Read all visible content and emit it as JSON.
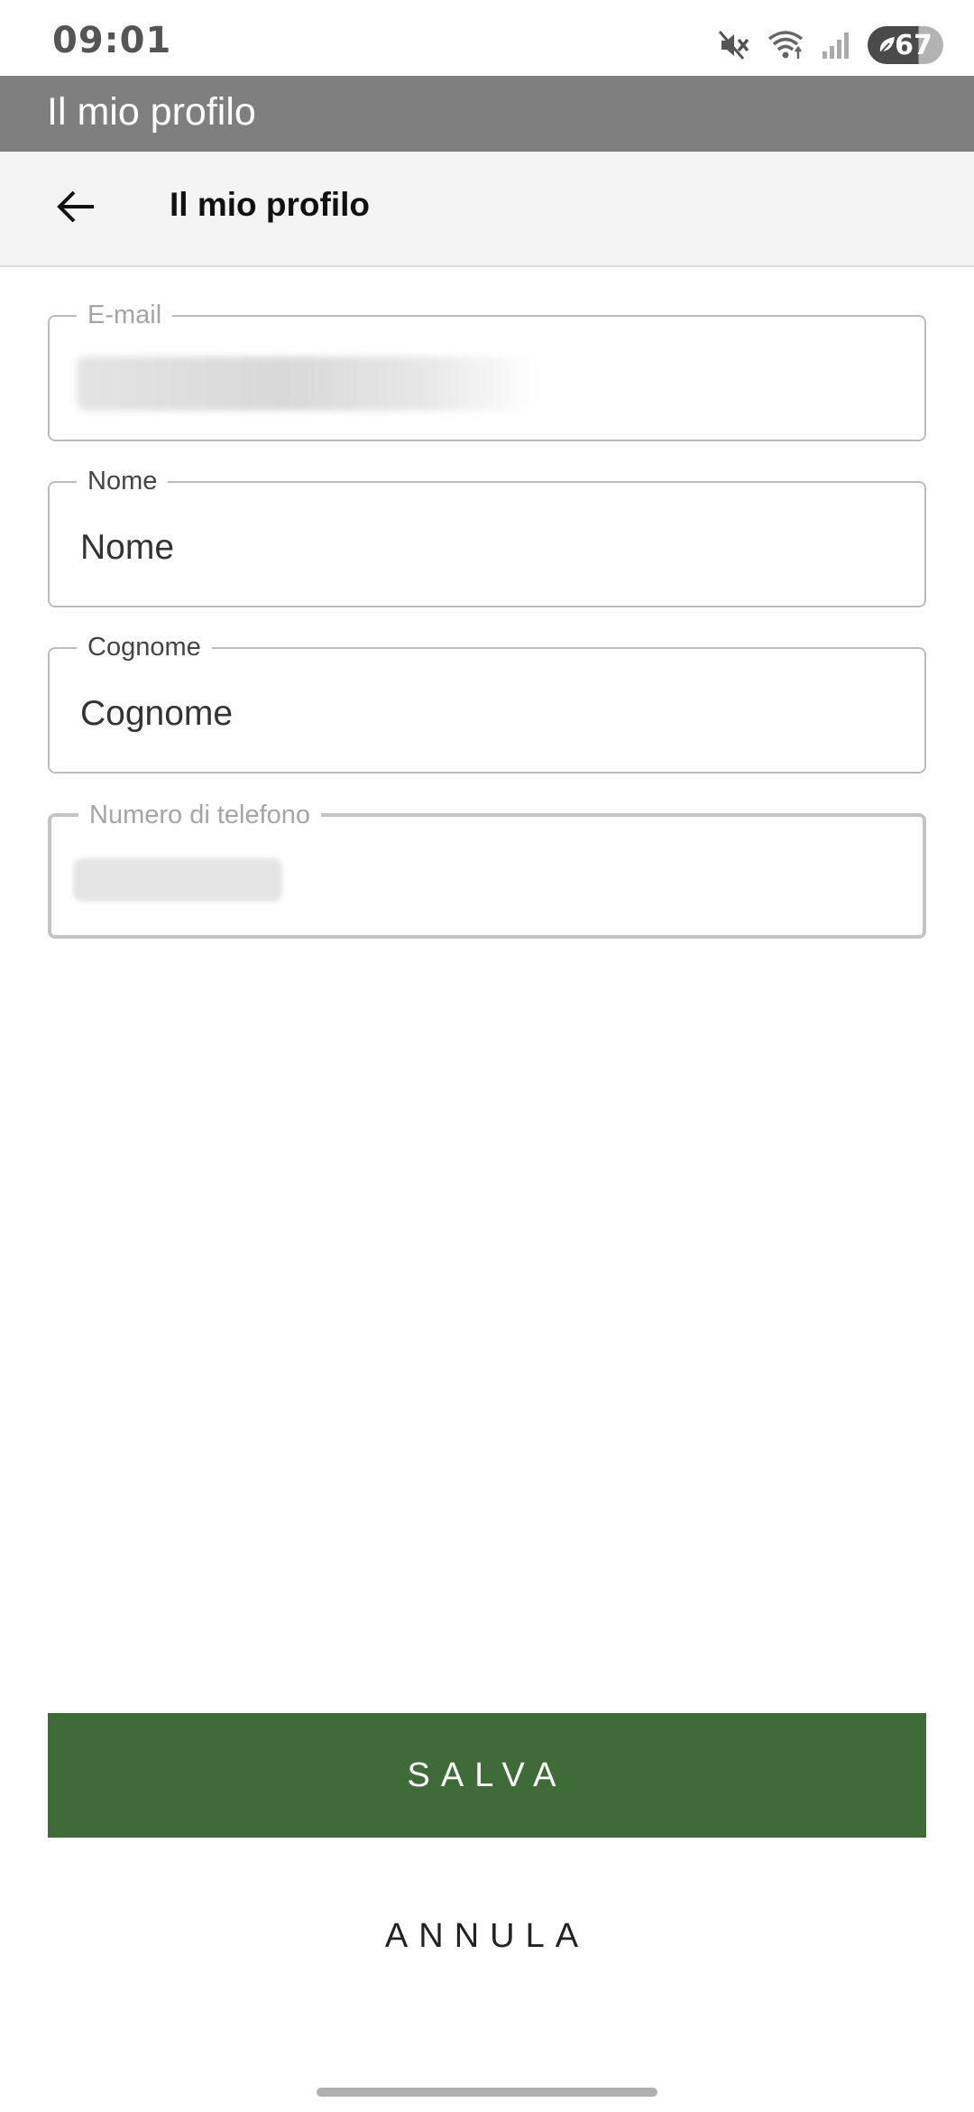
{
  "status_bar": {
    "time": "09:01",
    "battery_level": "67",
    "icons": [
      "mute-icon",
      "wifi-icon",
      "signal-icon",
      "battery-icon"
    ]
  },
  "app_bar": {
    "title": "Il mio profilo"
  },
  "header": {
    "title": "Il mio profilo",
    "back_icon": "arrow-left-icon"
  },
  "form": {
    "email": {
      "label": "E-mail",
      "value": ""
    },
    "first_name": {
      "label": "Nome",
      "placeholder": "Nome",
      "value": ""
    },
    "last_name": {
      "label": "Cognome",
      "placeholder": "Cognome",
      "value": ""
    },
    "phone": {
      "label": "Numero di telefono",
      "value": ""
    }
  },
  "actions": {
    "save_label": "SALVA",
    "cancel_label": "ANNULA"
  },
  "colors": {
    "primary": "#3e6b37",
    "app_bar": "#7f7f7f",
    "header_bg": "#f4f4f4",
    "field_border": "#bcbcbc"
  }
}
